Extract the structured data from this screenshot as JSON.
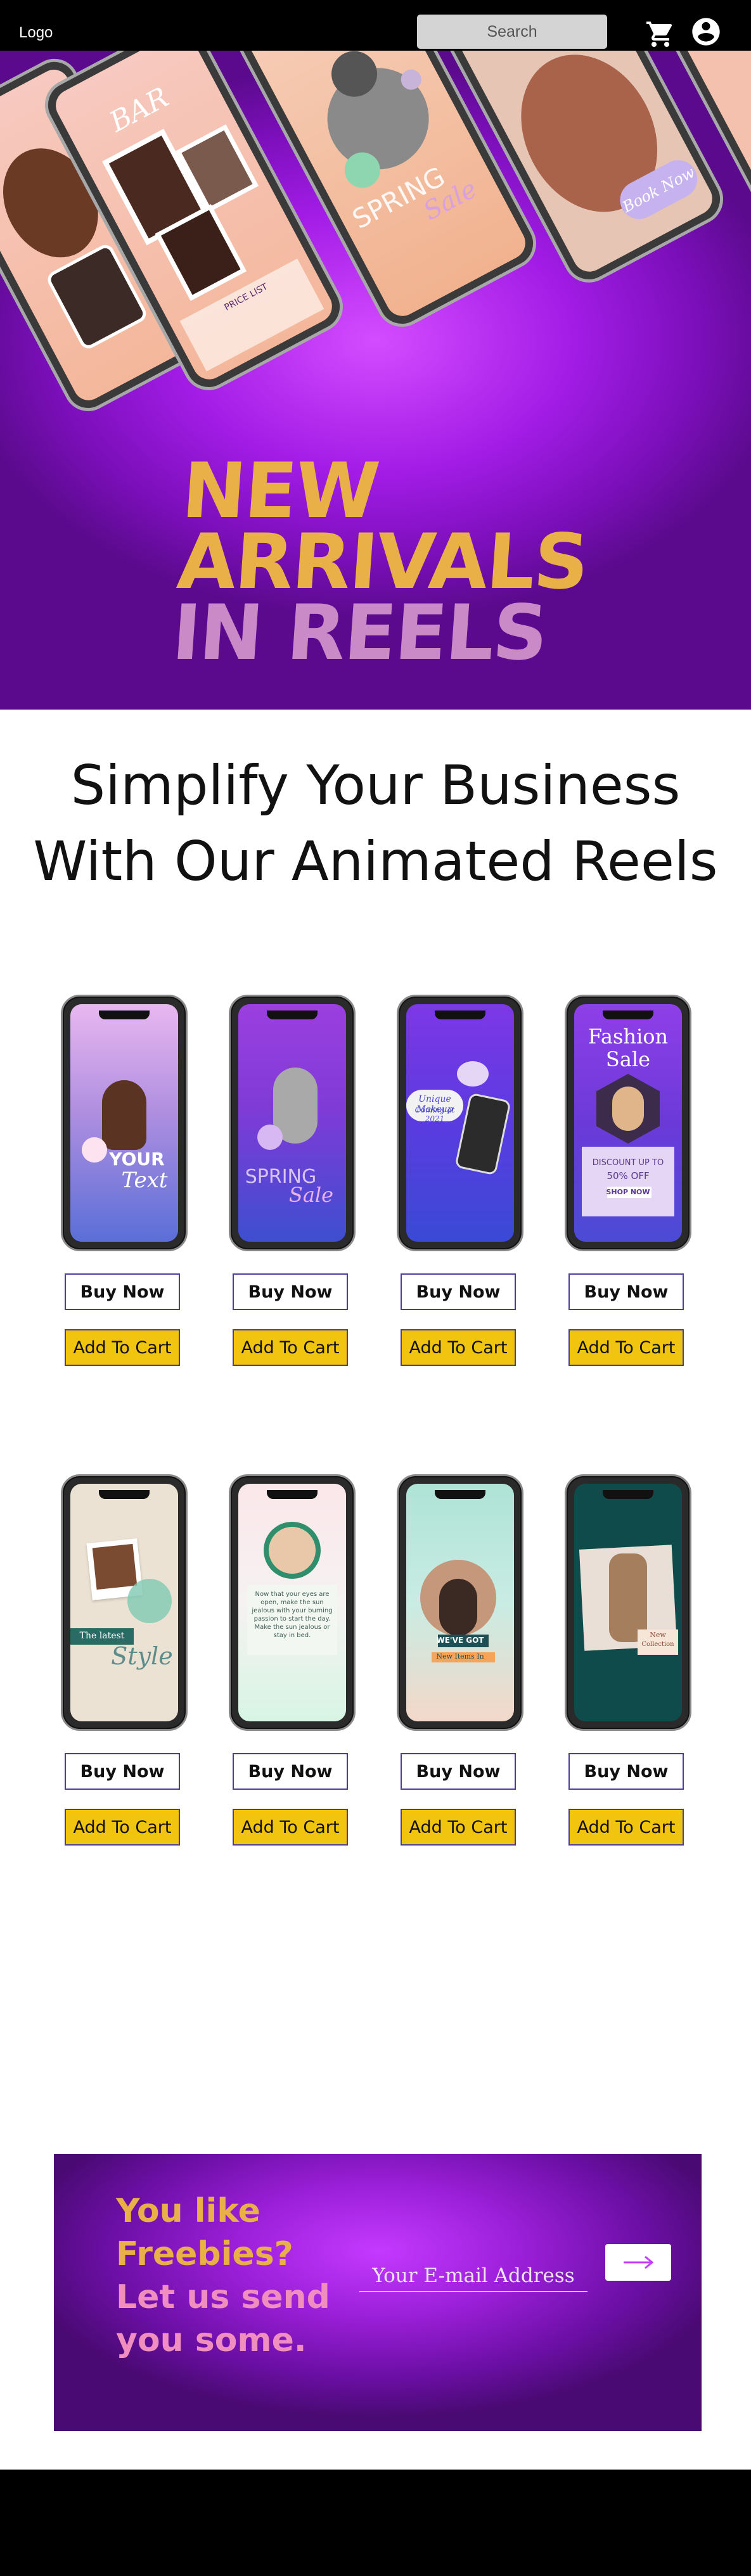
{
  "header": {
    "logo": "Logo",
    "search_label": "Search",
    "cart_icon": "shopping-cart-icon",
    "account_icon": "account-circle-icon"
  },
  "hero": {
    "title_line1": "NEW ARRIVALS",
    "title_line2": "IN REELS",
    "phone_texts": {
      "bar_title": "BAR",
      "price_list": "PRICE LIST",
      "spring": "SPRING",
      "sale": "Sale",
      "book_now": "Book Now"
    }
  },
  "headline": {
    "line1": "Simplify Your Business",
    "line2": "With Our Animated Reels"
  },
  "products": [
    {
      "screen_text": [
        "YOUR",
        "Text"
      ],
      "buy_label": "Buy Now",
      "cart_label": "Add To Cart"
    },
    {
      "screen_text": [
        "SPRING",
        "Sale"
      ],
      "buy_label": "Buy Now",
      "cart_label": "Add To Cart"
    },
    {
      "screen_text": [
        "Unique Makeup",
        "Coming at 2021"
      ],
      "buy_label": "Buy Now",
      "cart_label": "Add To Cart"
    },
    {
      "screen_text": [
        "Fashion",
        "Sale",
        "DISCOUNT UP TO",
        "50% OFF",
        "SHOP NOW"
      ],
      "buy_label": "Buy Now",
      "cart_label": "Add To Cart"
    },
    {
      "screen_text": [
        "The latest",
        "Style"
      ],
      "buy_label": "Buy Now",
      "cart_label": "Add To Cart"
    },
    {
      "screen_text": [
        "Now that your eyes are open, make the sun jealous with your burning passion to start the day. Make the sun jealous or stay in bed."
      ],
      "buy_label": "Buy Now",
      "cart_label": "Add To Cart"
    },
    {
      "screen_text": [
        "WE'VE GOT",
        "New Items In"
      ],
      "buy_label": "Buy Now",
      "cart_label": "Add To Cart"
    },
    {
      "screen_text": [
        "New",
        "Collection"
      ],
      "buy_label": "Buy Now",
      "cart_label": "Add To Cart"
    }
  ],
  "newsletter": {
    "line1": "You like",
    "line2": "Freebies?",
    "line3": "Let us send",
    "line4": "you some.",
    "email_placeholder": "Your E-mail Address",
    "submit_icon": "arrow-right-icon"
  },
  "colors": {
    "header_bg": "#000000",
    "hero_purple": "#a21ce6",
    "gold": "#e8b046",
    "pink": "#c98ac7",
    "button_yellow": "#f1c40f",
    "button_border": "#4b3d9e"
  }
}
